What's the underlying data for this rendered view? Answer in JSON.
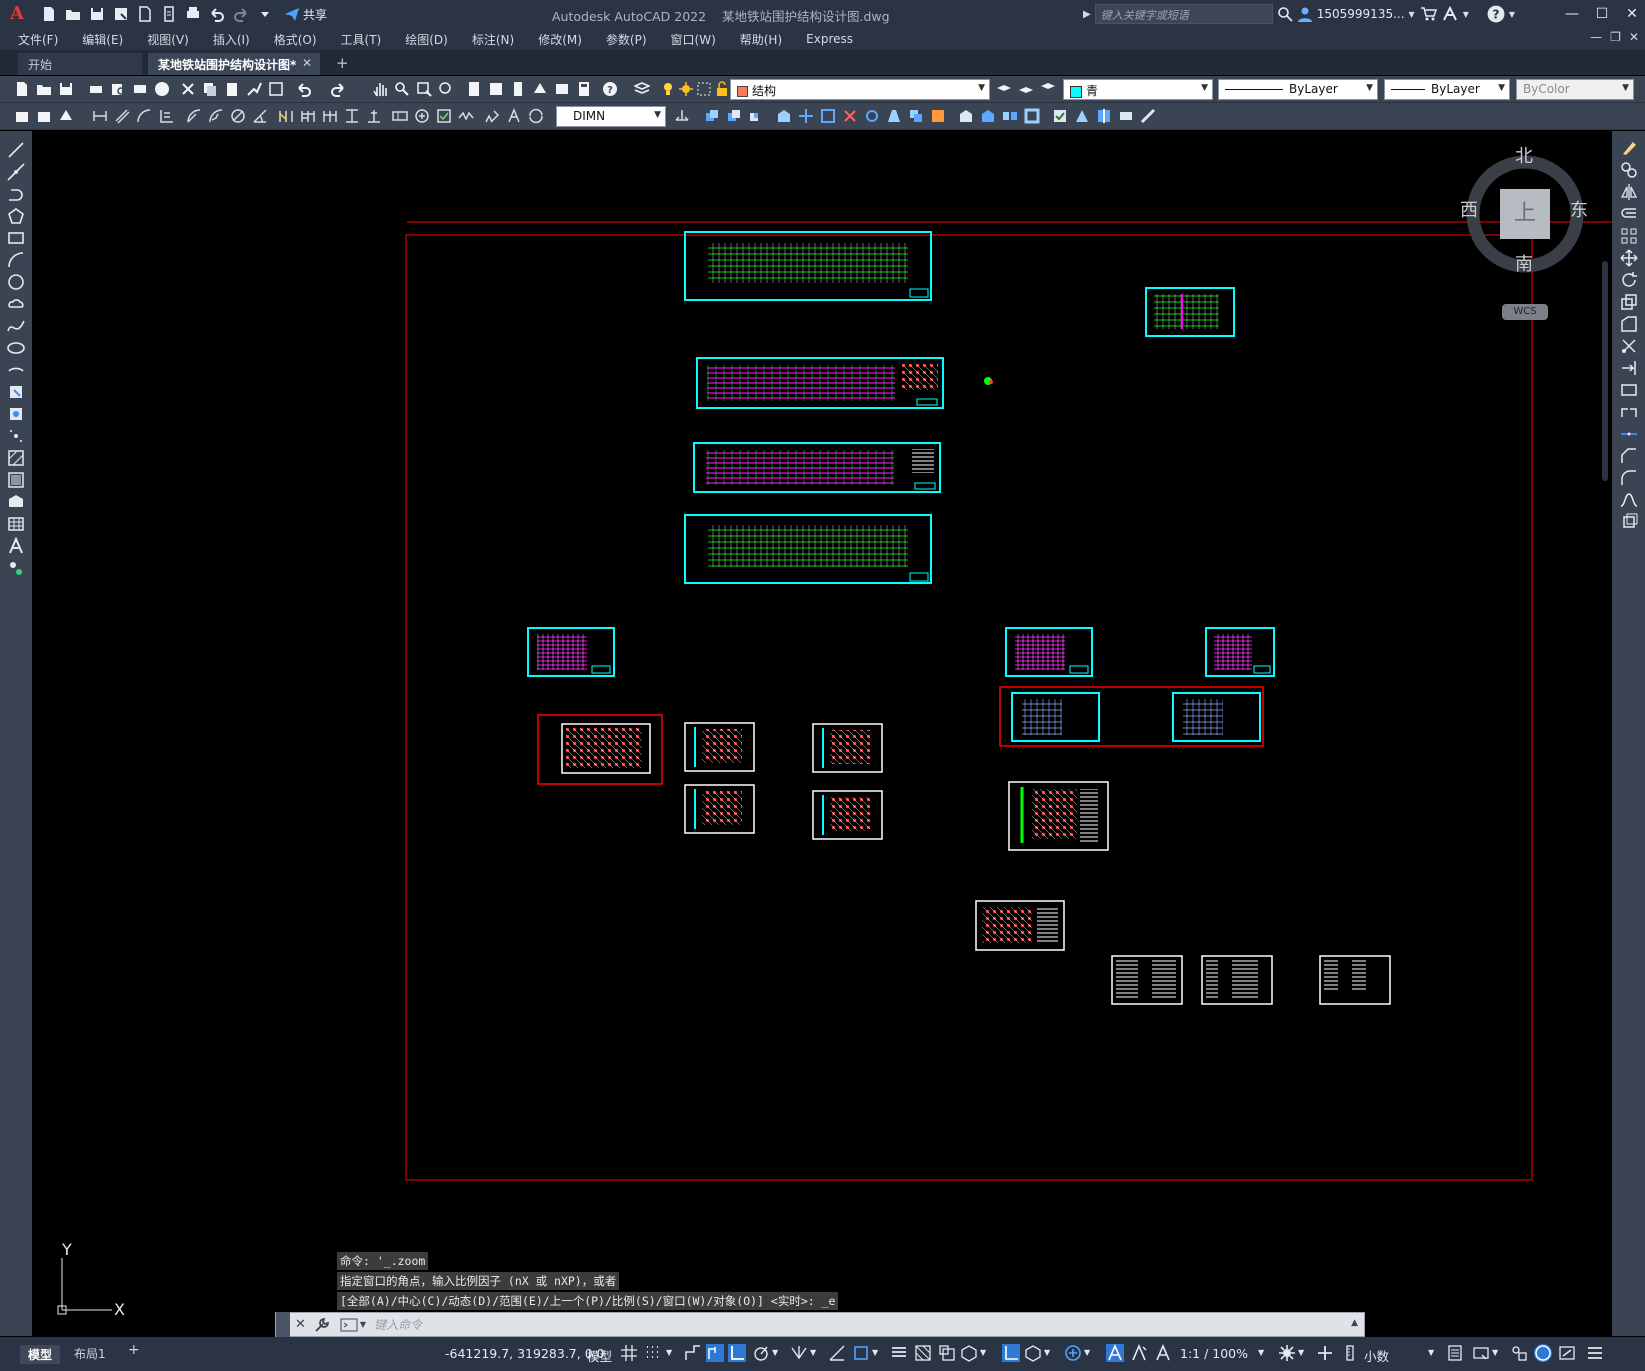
{
  "app": {
    "title": "Autodesk AutoCAD 2022",
    "document": "某地铁站围护结构设计图.dwg",
    "logo_letter": "A"
  },
  "quick_access": {
    "share_label": "共享"
  },
  "search": {
    "placeholder": "键入关键字或短语"
  },
  "user": {
    "name": "1505999135..."
  },
  "menu": {
    "items": [
      "文件(F)",
      "编辑(E)",
      "视图(V)",
      "插入(I)",
      "格式(O)",
      "工具(T)",
      "绘图(D)",
      "标注(N)",
      "修改(M)",
      "参数(P)",
      "窗口(W)",
      "帮助(H)",
      "Express"
    ]
  },
  "tabs": {
    "start": "开始",
    "active": "某地铁站围护结构设计图*",
    "add": "+"
  },
  "toolbar": {
    "layer": "结构",
    "color": "青",
    "linetype": "ByLayer",
    "lineweight": "ByLayer",
    "plotstyle": "ByColor",
    "dimstyle": "DIMN"
  },
  "viewcube": {
    "north": "北",
    "south": "南",
    "east": "东",
    "west": "西",
    "face": "上",
    "wcs": "WCS"
  },
  "ucs": {
    "x": "X",
    "y": "Y"
  },
  "command": {
    "history": [
      "命令: '_.zoom",
      "指定窗口的角点，输入比例因子 (nX 或 nXP)，或者",
      "[全部(A)/中心(C)/动态(D)/范围(E)/上一个(P)/比例(S)/窗口(W)/对象(O)] <实时>: _e"
    ],
    "placeholder": "键入命令"
  },
  "status": {
    "model_tab": "模型",
    "layout_tab": "布局1",
    "add_tab": "+",
    "coordinates": "-641219.7, 319283.7, 0.0",
    "space": "模型",
    "scale": "1:1 / 100%",
    "units": "小数"
  },
  "colors": {
    "drawing_bg": "#000000",
    "frame_cyan": "#00ffff",
    "frame_red": "#ff0000",
    "line_green": "#00ff00",
    "line_magenta": "#ff00ff",
    "chrome_dark": "#2b3445",
    "toolbar": "#3b4453"
  }
}
